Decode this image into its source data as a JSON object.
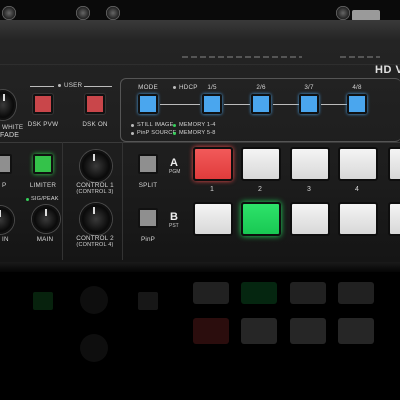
{
  "brand": {
    "model_text": "HD V"
  },
  "user_section": {
    "title": "USER"
  },
  "fade": {
    "label_white": "WHITE",
    "label_fade": "FADE"
  },
  "dsk": {
    "pvw_label": "DSK PVW",
    "on_label": "DSK ON"
  },
  "memory": {
    "mode_label": "MODE",
    "hdcp_label": "HDCP",
    "buttons": [
      "1/5",
      "2/6",
      "3/7",
      "4/8"
    ],
    "legend": {
      "still_image": "STILL IMAGE",
      "pinp_source": "PinP SOURCE",
      "memory_1_4": "MEMORY 1-4",
      "memory_5_8": "MEMORY 5-8"
    }
  },
  "audio": {
    "limiter_label": "LIMITER",
    "left_fragment_1": "P",
    "left_fragment_2": "IN",
    "sig_peak_label": "SIG/PEAK",
    "main_label": "MAIN"
  },
  "controls": {
    "control1_label": "CONTROL 1",
    "control1_sub": "(CONTROL 3)",
    "control2_label": "CONTROL 2",
    "control2_sub": "(CONTROL 4)"
  },
  "switcher": {
    "split_label": "SPLIT",
    "pinp_label": "PinP",
    "row_a": {
      "letter": "A",
      "sub": "PGM"
    },
    "row_b": {
      "letter": "B",
      "sub": "PST"
    },
    "channel_numbers": [
      "1",
      "2",
      "3",
      "4"
    ],
    "pgm_active": 1,
    "pst_active": 2
  },
  "colors": {
    "pgm_tally": "#e03b3b",
    "pst_tally": "#19c853",
    "memory_blue": "#4aa6ee",
    "dsk_red": "#c9464a"
  }
}
